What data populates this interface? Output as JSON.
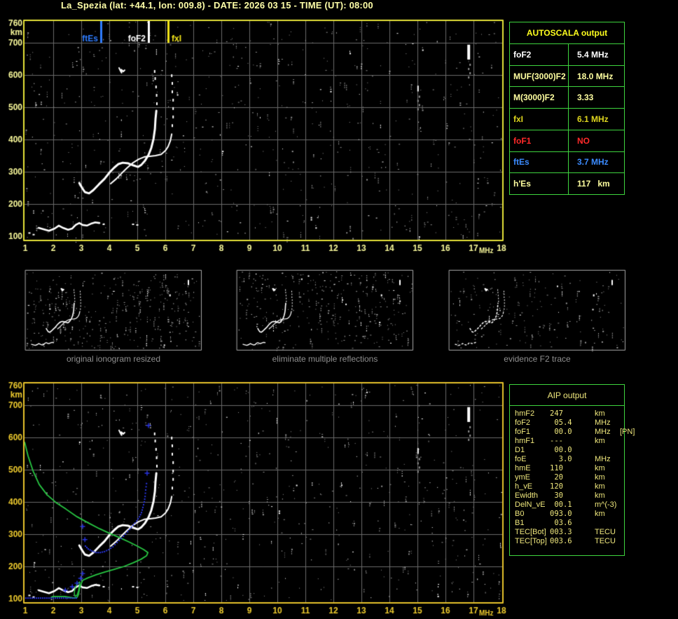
{
  "header": {
    "title": "La_Spezia (lat: +44.1, lon: 009.8) - DATE: 2026 03 15 - TIME (UT): 08:00"
  },
  "autoscala_table": {
    "title": "AUTOSCALA output",
    "header_color": "#ffff1e",
    "border_color": "#3ed43e",
    "rows": [
      {
        "label": "foF2",
        "value": "5.4 MHz",
        "color": "#ffffff"
      },
      {
        "label": "MUF(3000)F2",
        "value": "18.0 MHz",
        "color": "#ffffa0"
      },
      {
        "label": "M(3000)F2",
        "value": "3.33",
        "color": "#ffffa0"
      },
      {
        "label": "fxI",
        "value": "6.1 MHz",
        "color": "#ded51e"
      },
      {
        "label": "foF1",
        "value": "NO",
        "color": "#ff2a2a"
      },
      {
        "label": "ftEs",
        "value": "3.7 MHz",
        "color": "#3b8bff"
      },
      {
        "label": "h'Es",
        "value": "117   km",
        "color": "#ffffa0"
      }
    ]
  },
  "aip_table": {
    "title": "AIP output",
    "text_color": "#efe77c",
    "rows": [
      {
        "label": "hmF2",
        "value": "247",
        "unit": "km",
        "note": ""
      },
      {
        "label": "foF2",
        "value": " 05.4",
        "unit": "MHz",
        "note": ""
      },
      {
        "label": "foF1",
        "value": " 00.0",
        "unit": "MHz",
        "note": "[PN]"
      },
      {
        "label": "hmF1",
        "value": "---",
        "unit": "km",
        "note": ""
      },
      {
        "label": "D1",
        "value": " 00.0",
        "unit": "",
        "note": ""
      },
      {
        "label": "foE",
        "value": "  3.0",
        "unit": "MHz",
        "note": ""
      },
      {
        "label": "hmE",
        "value": "110",
        "unit": "km",
        "note": ""
      },
      {
        "label": "ymE",
        "value": " 20",
        "unit": "km",
        "note": ""
      },
      {
        "label": "h_vE",
        "value": "120",
        "unit": "km",
        "note": ""
      },
      {
        "label": "Ewidth",
        "value": " 30",
        "unit": "km",
        "note": ""
      },
      {
        "label": "DelN_vE",
        "value": " 00.1",
        "unit": "m^(-3)",
        "note": ""
      },
      {
        "label": "B0",
        "value": "093.0",
        "unit": "km",
        "note": ""
      },
      {
        "label": "B1",
        "value": " 03.6",
        "unit": "",
        "note": ""
      },
      {
        "label": "TEC[Bot]",
        "value": "003.3",
        "unit": "TECU",
        "note": ""
      },
      {
        "label": "TEC[Top]",
        "value": "003.6",
        "unit": "TECU",
        "note": ""
      }
    ]
  },
  "thumbnails": [
    {
      "caption": "original ionogram resized"
    },
    {
      "caption": "eliminate multiple reflections"
    },
    {
      "caption": "evidence F2 trace"
    }
  ],
  "chart_data": {
    "type": "scatter",
    "title": "ionogram virtual height vs frequency",
    "xlabel": "MHz",
    "ylabel": "km",
    "xlim": [
      1,
      18
    ],
    "ylim": [
      88,
      768
    ],
    "grid": true,
    "x_ticks": [
      1,
      2,
      3,
      4,
      5,
      6,
      7,
      8,
      9,
      10,
      11,
      12,
      13,
      14,
      15,
      16,
      17,
      18
    ],
    "y_ticks": [
      760,
      700,
      600,
      500,
      400,
      300,
      200,
      100
    ],
    "plot_styles": {
      "top": {
        "border": "#e6e23a",
        "labels": "#f8f89a"
      },
      "bottom": {
        "border": "#e7c22b",
        "labels": "#eecb2e"
      },
      "grid_color": "#6b6b6b",
      "noise_gray": "#949494",
      "trace_color": "#ffffff"
    },
    "markers": [
      {
        "name": "ftEs",
        "label": "ftEs",
        "freq_mhz": 3.7,
        "color": "#2f7dff",
        "label_side": "left"
      },
      {
        "name": "foF2",
        "label": "foF2",
        "freq_mhz": 5.4,
        "color": "#ffffff",
        "label_side": "left"
      },
      {
        "name": "fxI",
        "label": "fxI",
        "freq_mhz": 6.1,
        "color": "#f0e318",
        "label_side": "right"
      }
    ],
    "echo_traces": {
      "es_layer": [
        [
          1.48,
          126
        ],
        [
          1.65,
          122
        ],
        [
          1.85,
          117
        ],
        [
          2.05,
          124
        ],
        [
          2.2,
          133
        ],
        [
          2.35,
          126
        ],
        [
          2.53,
          120
        ],
        [
          2.68,
          124
        ],
        [
          2.8,
          135
        ],
        [
          2.93,
          141
        ],
        [
          3.05,
          135
        ],
        [
          3.2,
          133
        ],
        [
          3.35,
          139
        ],
        [
          3.5,
          143
        ],
        [
          3.65,
          141
        ]
      ],
      "es_dots": [
        [
          1.15,
          110
        ],
        [
          1.3,
          105
        ],
        [
          3.8,
          137
        ],
        [
          4.85,
          137
        ],
        [
          5.0,
          135
        ]
      ],
      "f_ordinary": [
        [
          2.93,
          265
        ],
        [
          3.03,
          250
        ],
        [
          3.13,
          237
        ],
        [
          3.28,
          233
        ],
        [
          3.43,
          243
        ],
        [
          3.63,
          261
        ],
        [
          3.83,
          278
        ],
        [
          4.03,
          300
        ],
        [
          4.18,
          313
        ],
        [
          4.33,
          324
        ],
        [
          4.48,
          328
        ],
        [
          4.68,
          326
        ],
        [
          4.85,
          320
        ],
        [
          5.03,
          315
        ],
        [
          5.15,
          322
        ],
        [
          5.28,
          335
        ],
        [
          5.4,
          352
        ],
        [
          5.5,
          374
        ],
        [
          5.58,
          402
        ],
        [
          5.63,
          433
        ],
        [
          5.65,
          463
        ],
        [
          5.68,
          489
        ]
      ],
      "f_ordinary_spread": [
        [
          5.7,
          511
        ],
        [
          5.69,
          537
        ],
        [
          5.67,
          563
        ],
        [
          5.64,
          589
        ],
        [
          5.62,
          611
        ]
      ],
      "f_extraordinary": [
        [
          4.05,
          263
        ],
        [
          4.25,
          278
        ],
        [
          4.45,
          296
        ],
        [
          4.65,
          313
        ],
        [
          4.85,
          328
        ],
        [
          5.05,
          339
        ],
        [
          5.25,
          346
        ],
        [
          5.45,
          348
        ],
        [
          5.65,
          350
        ],
        [
          5.85,
          354
        ],
        [
          6.0,
          365
        ],
        [
          6.1,
          378
        ],
        [
          6.18,
          396
        ],
        [
          6.23,
          417
        ]
      ],
      "f_extraordinary_spread": [
        [
          6.25,
          443
        ],
        [
          6.28,
          470
        ],
        [
          6.28,
          496
        ],
        [
          6.28,
          522
        ],
        [
          6.25,
          548
        ],
        [
          6.25,
          574
        ],
        [
          6.23,
          598
        ]
      ],
      "second_hop_blob": [
        [
          4.35,
          622
        ],
        [
          4.4,
          613
        ],
        [
          4.44,
          607
        ],
        [
          4.43,
          617
        ],
        [
          4.5,
          611
        ],
        [
          4.55,
          615
        ]
      ],
      "interference_streaks": [
        {
          "f": 16.83,
          "h_from": 648,
          "h_to": 694,
          "w": 4
        },
        {
          "f": 15.02,
          "h_from": 549,
          "h_to": 567,
          "w": 2
        }
      ]
    },
    "profile_green": {
      "color": "#28c743",
      "main": [
        [
          0.98,
          585
        ],
        [
          1.1,
          543
        ],
        [
          1.28,
          496
        ],
        [
          1.5,
          454
        ],
        [
          1.78,
          422
        ],
        [
          2.1,
          398
        ],
        [
          2.45,
          378
        ],
        [
          2.85,
          354
        ],
        [
          3.25,
          335
        ],
        [
          3.65,
          317
        ],
        [
          4.03,
          302
        ],
        [
          4.38,
          289
        ],
        [
          4.7,
          276
        ],
        [
          5.0,
          263
        ],
        [
          5.23,
          252
        ],
        [
          5.38,
          243
        ],
        [
          5.33,
          233
        ],
        [
          5.13,
          222
        ],
        [
          4.85,
          211
        ],
        [
          4.53,
          200
        ],
        [
          4.18,
          191
        ],
        [
          3.85,
          183
        ],
        [
          3.53,
          174
        ],
        [
          3.25,
          165
        ],
        [
          3.05,
          157
        ],
        [
          2.98,
          143
        ],
        [
          2.93,
          128
        ],
        [
          2.9,
          113
        ],
        [
          2.85,
          104
        ],
        [
          2.75,
          102
        ],
        [
          2.6,
          104
        ],
        [
          2.4,
          107
        ],
        [
          2.2,
          107
        ],
        [
          2.0,
          107
        ],
        [
          1.93,
          104
        ]
      ],
      "valley_loop": [
        [
          2.95,
          152
        ],
        [
          2.85,
          146
        ],
        [
          2.78,
          133
        ],
        [
          2.75,
          117
        ],
        [
          2.78,
          107
        ],
        [
          2.85,
          111
        ],
        [
          2.9,
          124
        ],
        [
          2.93,
          139
        ],
        [
          2.95,
          152
        ]
      ]
    },
    "fitted_trace_blue": {
      "color": "#2a36e6",
      "baseline": {
        "h": 104,
        "f_from": 1.0,
        "f_to": 2.85
      },
      "es_plus_marks": [
        [
          2.43,
          126
        ],
        [
          2.68,
          137
        ],
        [
          2.85,
          148
        ],
        [
          2.98,
          163
        ],
        [
          3.05,
          178
        ]
      ],
      "points": [
        [
          3.15,
          263
        ],
        [
          3.25,
          254
        ],
        [
          3.38,
          248
        ],
        [
          3.53,
          243
        ],
        [
          3.68,
          243
        ],
        [
          3.83,
          246
        ],
        [
          3.98,
          252
        ],
        [
          4.13,
          261
        ],
        [
          4.28,
          274
        ],
        [
          4.43,
          287
        ],
        [
          4.58,
          300
        ],
        [
          4.73,
          315
        ],
        [
          4.85,
          328
        ],
        [
          4.98,
          341
        ],
        [
          5.08,
          354
        ],
        [
          5.15,
          367
        ],
        [
          5.2,
          383
        ],
        [
          5.25,
          400
        ],
        [
          5.28,
          417
        ],
        [
          5.3,
          437
        ],
        [
          5.33,
          457
        ]
      ],
      "plus_marks": [
        [
          5.35,
          489
        ],
        [
          5.4,
          637
        ],
        [
          3.05,
          324
        ],
        [
          3.13,
          283
        ]
      ]
    },
    "noise": {
      "top_count": 640,
      "bottom_count": 640,
      "thumb_counts": [
        340,
        300,
        180
      ]
    }
  }
}
